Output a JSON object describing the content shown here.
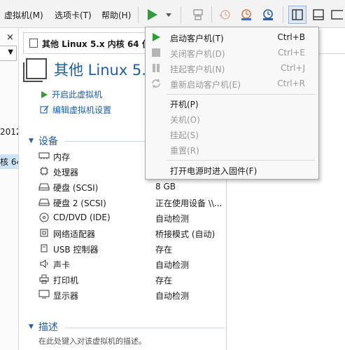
{
  "menubar": {
    "items": [
      {
        "label": "虚拟机(M)"
      },
      {
        "label": "选项卡(T)"
      },
      {
        "label": "帮助(H)"
      }
    ]
  },
  "toolbar": {
    "play_icon": "play-icon",
    "play_color": "#2e9e3a",
    "buttons": [
      {
        "icon": "send-keys-icon"
      },
      {
        "icon": "snapshot-revert-icon"
      },
      {
        "icon": "snapshot-take-icon"
      },
      {
        "icon": "snapshot-manager-icon"
      },
      {
        "icon": "sidebar-toggle-icon"
      },
      {
        "icon": "console-view-icon"
      },
      {
        "icon": "fullscreen-icon"
      }
    ]
  },
  "library": {
    "close_glyph": "×",
    "fragments": [
      "2012",
      "核 64"
    ]
  },
  "tab": {
    "label": "其他 Linux 5.x 内核 64 位"
  },
  "vm": {
    "title": "其他 Linux 5.x",
    "actions": [
      {
        "label": "开启此虚拟机",
        "icon": "play-icon"
      },
      {
        "label": "编辑虚拟机设置",
        "icon": "edit-settings-icon"
      }
    ]
  },
  "devices": {
    "heading": "设备",
    "items": [
      {
        "name": "内存",
        "value": "",
        "icon": "memory-icon"
      },
      {
        "name": "处理器",
        "value": "",
        "icon": "cpu-icon"
      },
      {
        "name": "硬盘 (SCSI)",
        "value": "8 GB",
        "icon": "hard-disk-icon"
      },
      {
        "name": "硬盘 2 (SCSI)",
        "value": "正在使用设备 \\\\...",
        "icon": "hard-disk-icon"
      },
      {
        "name": "CD/DVD (IDE)",
        "value": "自动检测",
        "icon": "cd-dvd-icon"
      },
      {
        "name": "网络适配器",
        "value": "桥接模式 (自动)",
        "icon": "network-adapter-icon"
      },
      {
        "name": "USB 控制器",
        "value": "存在",
        "icon": "usb-icon"
      },
      {
        "name": "声卡",
        "value": "自动检测",
        "icon": "sound-card-icon"
      },
      {
        "name": "打印机",
        "value": "存在",
        "icon": "printer-icon"
      },
      {
        "name": "显示器",
        "value": "自动检测",
        "icon": "display-icon"
      }
    ]
  },
  "description": {
    "heading": "描述",
    "placeholder": "在此处键入对该虚拟机的描述。"
  },
  "power_menu": {
    "items": [
      {
        "label": "启动客户机(T)",
        "shortcut": "Ctrl+B",
        "icon": "play-icon",
        "enabled": true
      },
      {
        "label": "关闭客户机(D)",
        "shortcut": "Ctrl+E",
        "icon": "stop-icon",
        "enabled": false
      },
      {
        "label": "挂起客户机(N)",
        "shortcut": "Ctrl+J",
        "icon": "pause-icon",
        "enabled": false
      },
      {
        "label": "重新启动客户机(E)",
        "shortcut": "Ctrl+R",
        "icon": "restart-icon",
        "enabled": false
      },
      {
        "label": "开机(P)",
        "shortcut": "",
        "icon": "",
        "enabled": true
      },
      {
        "label": "关机(O)",
        "shortcut": "",
        "icon": "",
        "enabled": false
      },
      {
        "label": "挂起(S)",
        "shortcut": "",
        "icon": "",
        "enabled": false
      },
      {
        "label": "重置(R)",
        "shortcut": "",
        "icon": "",
        "enabled": false
      },
      {
        "label": "打开电源时进入固件(F)",
        "shortcut": "",
        "icon": "",
        "enabled": true
      }
    ]
  },
  "colors": {
    "accent": "#1e5fa8",
    "play_green": "#2e9e3a",
    "disabled_text": "#9a9a9a"
  }
}
